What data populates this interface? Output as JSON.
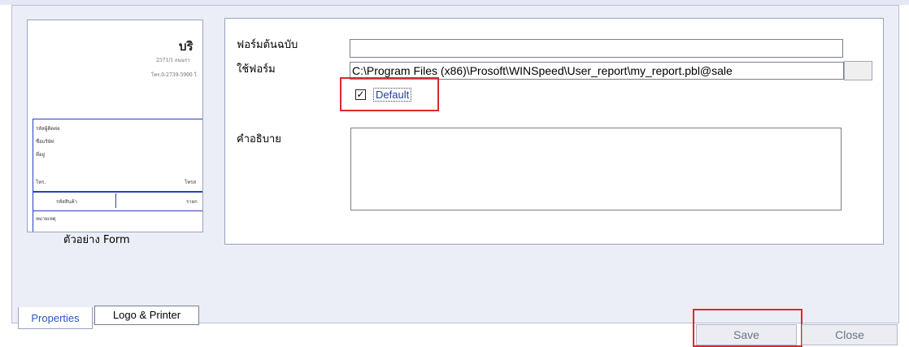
{
  "preview": {
    "caption": "ตัวอย่าง Form",
    "company_fragment": "บริ",
    "address_fragment": "2571/1 ถนนรา",
    "phone_fragment": "โทร.0-2739-5900 โ",
    "customer_lines": [
      "รหัสผู้ติดต่อ",
      "ชื่อบริษัท",
      "ที่อยู่"
    ],
    "tel_label": "โทร.",
    "fax_label": "โทรส",
    "table_header_left": "รหัสสินค้า",
    "table_header_right": "รายก",
    "remark_label": "หมายเหตุ"
  },
  "form": {
    "original_form_label": "ฟอร์มต้นฉบับ",
    "original_form_value": "",
    "use_form_label": "ใช้ฟอร์ม",
    "use_form_value": "C:\\Program Files (x86)\\Prosoft\\WINSpeed\\User_report\\my_report.pbl@sale",
    "default_label": "Default",
    "default_checked": "✓",
    "description_label": "คำอธิบาย",
    "description_value": ""
  },
  "tabs": [
    {
      "label": "Properties",
      "active": true
    },
    {
      "label": "Logo & Printer",
      "active": false
    }
  ],
  "buttons": {
    "save_label": "Save",
    "close_label": "Close"
  },
  "colors": {
    "highlight": "#e0272d",
    "active_tab_text": "#2a57c6",
    "panel_background": "#eceef7"
  }
}
